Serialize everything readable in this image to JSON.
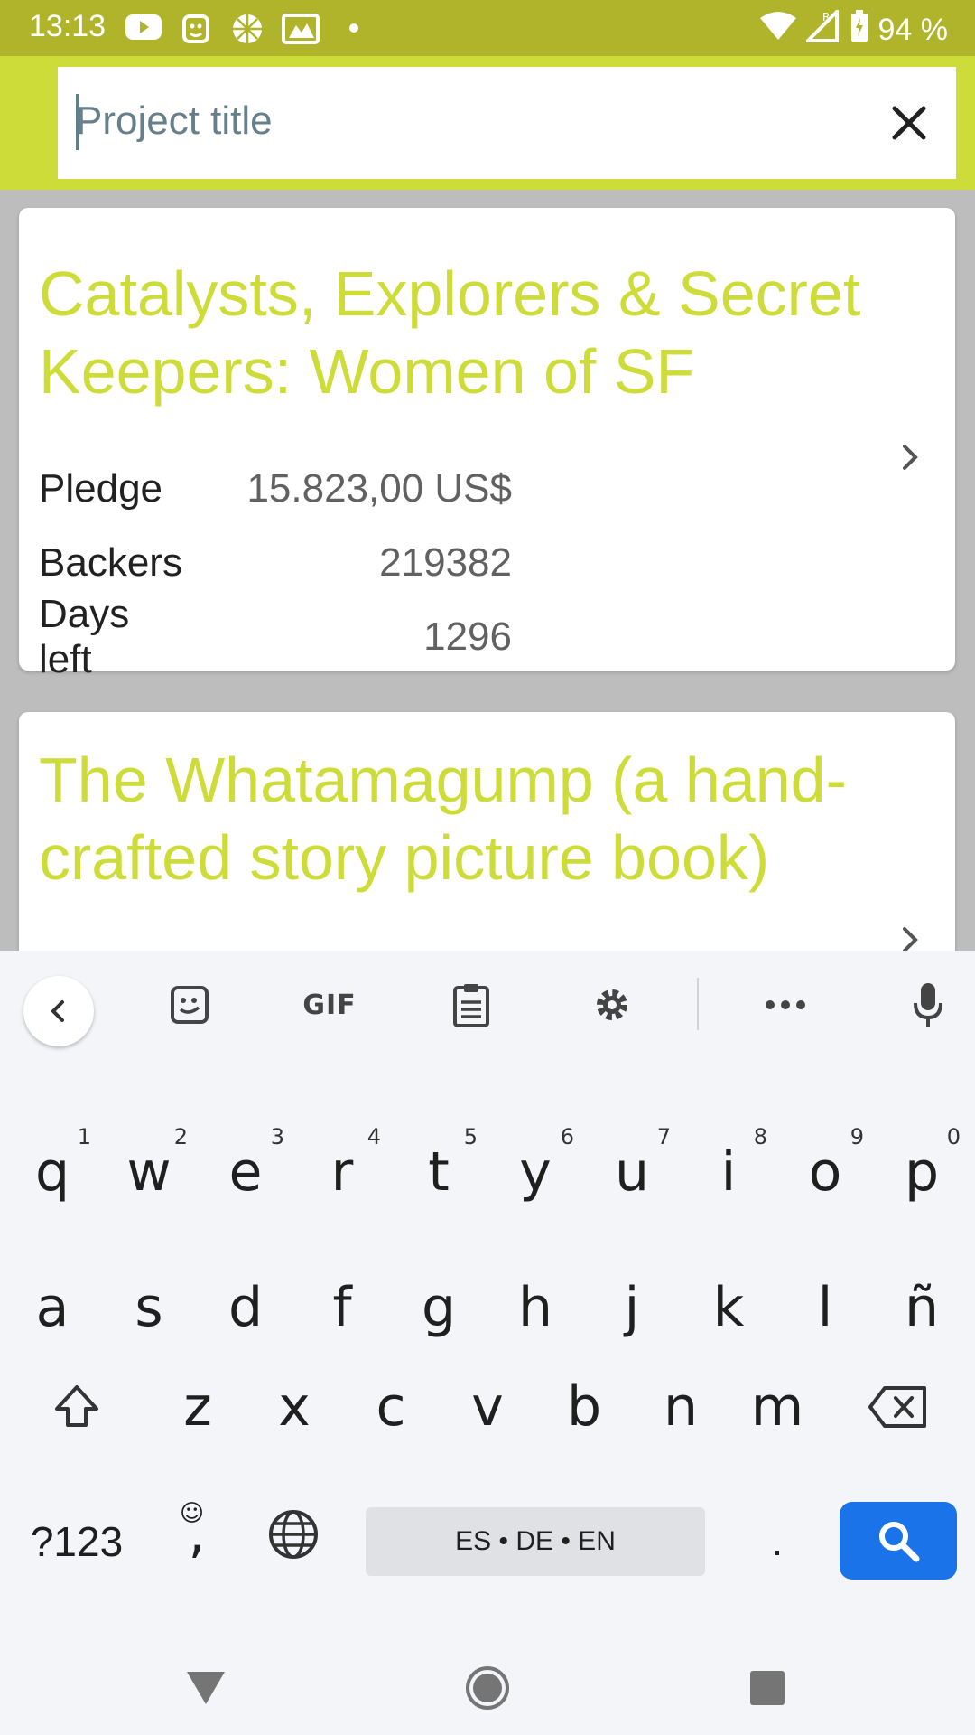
{
  "status_bar": {
    "time": "13:13",
    "battery": "94 %"
  },
  "search": {
    "placeholder": "Project title",
    "value": ""
  },
  "projects": [
    {
      "title": "Catalysts, Explorers & Secret Keepers: Women of SF",
      "pledge_label": "Pledge",
      "pledge_value": "15.823,00 US$",
      "backers_label": "Backers",
      "backers_value": "219382",
      "days_label": "Days left",
      "days_value": "1296"
    },
    {
      "title": "The Whatamagump (a hand-crafted story picture book)"
    }
  ],
  "keyboard": {
    "gif_label": "GIF",
    "row1": [
      {
        "k": "q",
        "h": "1"
      },
      {
        "k": "w",
        "h": "2"
      },
      {
        "k": "e",
        "h": "3"
      },
      {
        "k": "r",
        "h": "4"
      },
      {
        "k": "t",
        "h": "5"
      },
      {
        "k": "y",
        "h": "6"
      },
      {
        "k": "u",
        "h": "7"
      },
      {
        "k": "i",
        "h": "8"
      },
      {
        "k": "o",
        "h": "9"
      },
      {
        "k": "p",
        "h": "0"
      }
    ],
    "row2": [
      "a",
      "s",
      "d",
      "f",
      "g",
      "h",
      "j",
      "k",
      "l",
      "ñ"
    ],
    "row3": [
      "z",
      "x",
      "c",
      "v",
      "b",
      "n",
      "m"
    ],
    "symbols_label": "?123",
    "comma_label": ",",
    "space_label": "ES • DE • EN",
    "period_label": "."
  },
  "colors": {
    "status_bar": "#afb42b",
    "toolbar": "#cddc39",
    "title": "#cddc39",
    "search_key": "#1a73e8"
  }
}
